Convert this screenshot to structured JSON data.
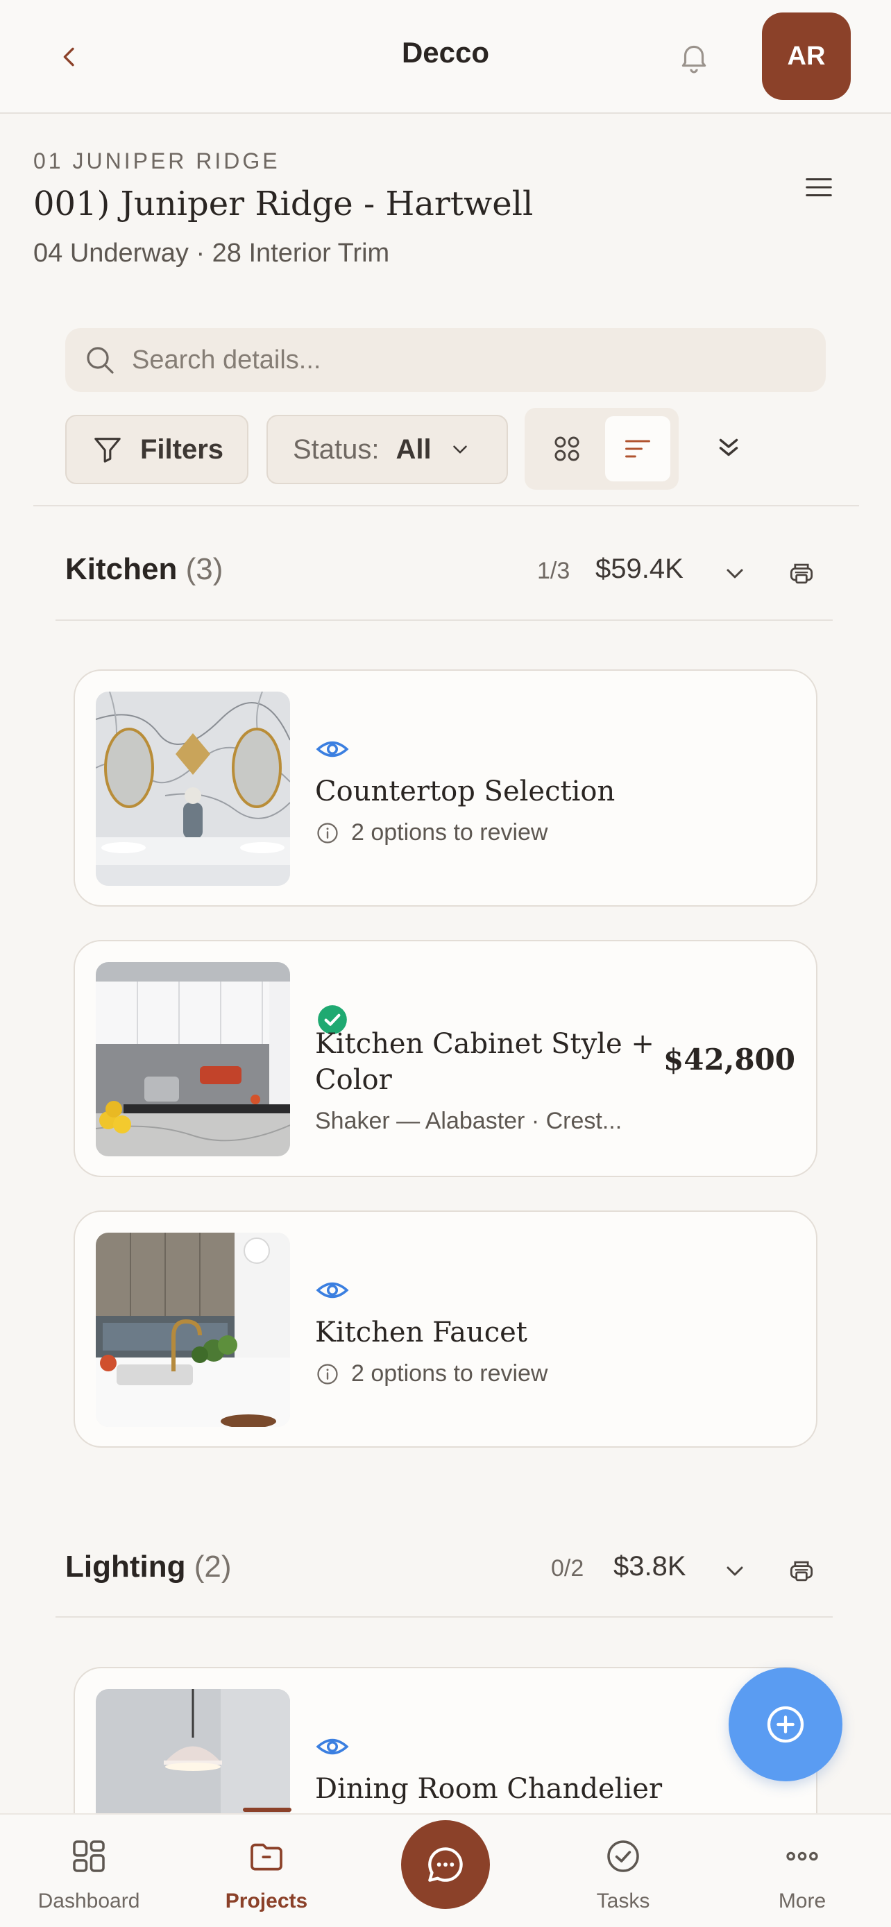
{
  "header": {
    "title": "Decco",
    "avatar_initials": "AR"
  },
  "project": {
    "code": "01 JUNIPER RIDGE",
    "title": "001) Juniper Ridge - Hartwell",
    "subtitle": "04 Underway · 28 Interior Trim"
  },
  "search": {
    "placeholder": "Search details..."
  },
  "toolbar": {
    "filters_label": "Filters",
    "status_label": "Status:",
    "status_value": "All"
  },
  "sections": [
    {
      "name": "Kitchen",
      "count": "(3)",
      "progress": "1/3",
      "total": "$59.4K",
      "items": [
        {
          "title": "Countertop Selection",
          "status": "review",
          "meta": "2 options to review",
          "price": ""
        },
        {
          "title": "Kitchen Cabinet Style + Color",
          "title_line1": "Kitchen Cabinet Style +",
          "title_line2": "Color",
          "status": "approved",
          "meta": "Shaker — Alabaster · Crest...",
          "price": "$42,800"
        },
        {
          "title": "Kitchen Faucet",
          "status": "review",
          "meta": "2 options to review",
          "price": ""
        }
      ]
    },
    {
      "name": "Lighting",
      "count": "(2)",
      "progress": "0/2",
      "total": "$3.8K",
      "items": [
        {
          "title": "Dining Room Chandelier",
          "status": "review"
        }
      ]
    }
  ],
  "bottom_nav": {
    "items": [
      {
        "label": "Dashboard",
        "icon": "dashboard-icon",
        "active": false
      },
      {
        "label": "Projects",
        "icon": "folder-icon",
        "active": true
      },
      {
        "label": "Tasks",
        "icon": "check-circle-icon",
        "active": false
      },
      {
        "label": "More",
        "icon": "more-dots-icon",
        "active": false
      }
    ]
  },
  "colors": {
    "brand": "#8b4129",
    "accent_blue": "#5a9cf2",
    "review_icon": "#3b7fe0",
    "approved": "#1fa971",
    "background": "#f8f6f3"
  }
}
